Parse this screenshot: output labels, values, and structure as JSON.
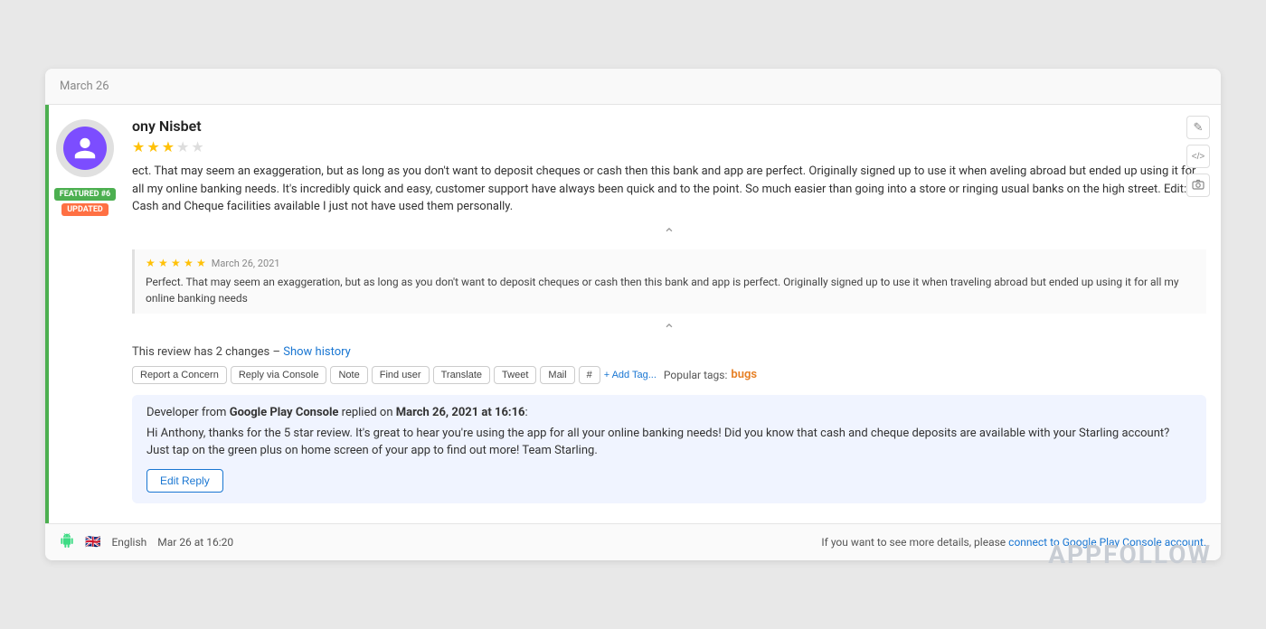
{
  "watermark": "APPFOLLOW",
  "header": {
    "date": "March 26"
  },
  "badges": {
    "featured": "FEATURED #6",
    "updated": "UPDATED"
  },
  "reviewer": {
    "name": "ony Nisbet",
    "stars": 3,
    "max_stars": 5
  },
  "review_text": "ect. That may seem an exaggeration, but as long as you don't want to deposit cheques or cash then this bank and app are perfect. Originally signed up to use it when aveling abroad but ended up using it for all my online banking needs. It's incredibly quick and easy, customer support have always been quick and to the point. So much easier than going into a store or ringing usual banks on the high street. Edit: Cash and Cheque facilities available I just not have used them personally.",
  "original_review": {
    "stars": 5,
    "date": "March 26, 2021",
    "text": "Perfect. That may seem an exaggeration, but as long as you don't want to deposit cheques or cash then this bank and app is perfect. Originally signed up to use it when traveling abroad but ended up using it for all my online banking needs"
  },
  "changes": {
    "label": "This review has 2 changes –",
    "link_text": "Show history"
  },
  "action_buttons": {
    "report": "Report a Concern",
    "reply": "Reply via Console",
    "note": "Note",
    "find_user": "Find user",
    "translate": "Translate",
    "tweet": "Tweet",
    "mail": "Mail",
    "hash": "#",
    "add_tag": "+ Add Tag...",
    "popular_tags_label": "Popular tags:",
    "popular_tag": "bugs"
  },
  "developer_reply": {
    "prefix": "Developer from",
    "console_name": "Google Play Console",
    "replied_on": "replied on",
    "date": "March 26, 2021 at 16:16",
    "text": "Hi Anthony, thanks for the 5 star review. It's great to hear you're using the app for all your online banking needs! Did you know that cash and cheque deposits are available with your Starling account? Just tap on the green plus on home screen of your app to find out more! Team Starling.",
    "edit_button": "Edit Reply"
  },
  "footer": {
    "language": "English",
    "date": "Mar 26 at 16:20",
    "console_prompt": "If you want to see more details, please",
    "console_link": "connect to Google Play Console account."
  },
  "right_icons": {
    "edit": "✎",
    "code": "</>",
    "camera": "📷"
  }
}
